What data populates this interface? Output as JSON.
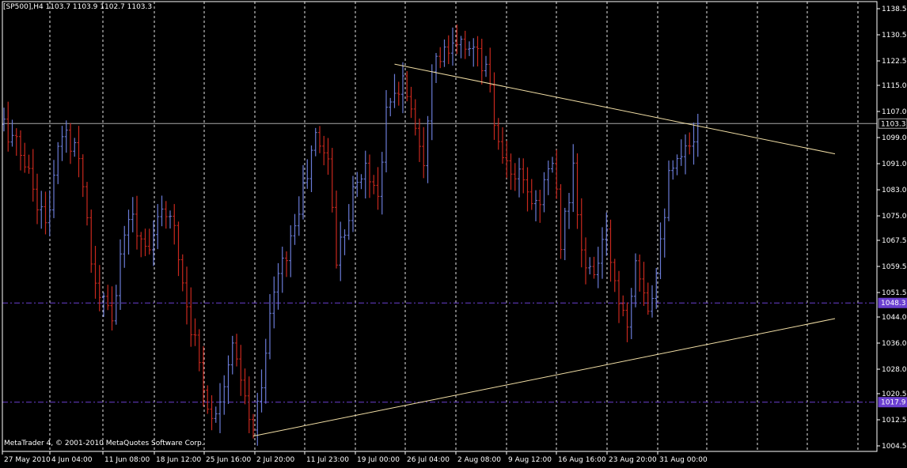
{
  "header": {
    "symbol_info": "[SP500],H4  1103.7 1103.9 1102.7 1103.3"
  },
  "copyright": "MetaTrader 4, © 2001-2010 MetaQuotes Software Corp.",
  "colors": {
    "background": "#000000",
    "grid": "#ffffff",
    "bull_bar": "#6a7bd6",
    "bear_bar": "#c8281e",
    "trendline": "#f2dfa6",
    "hline_current": "#a8a8a8",
    "hline_levels": "#6a3fd0",
    "axis_text": "#ffffff"
  },
  "chart_data": {
    "type": "ohlc-bar",
    "instrument": "SP500",
    "timeframe": "H4",
    "ylim": [
      1000.0,
      1140.0
    ],
    "y_ticks": [
      1138.5,
      1130.5,
      1122.5,
      1115.0,
      1107.0,
      1099.0,
      1091.0,
      1083.0,
      1075.0,
      1067.5,
      1059.5,
      1051.5,
      1044.0,
      1036.0,
      1028.0,
      1020.5,
      1012.5,
      1004.5
    ],
    "y_tick_labels": [
      "1138.5",
      "1130.5",
      "1122.5",
      "1115.0",
      "1107.0",
      "1099.0",
      "1091.0",
      "1083.0",
      "1075.0",
      "1067.5",
      "1059.5",
      "1051.5",
      "1044.0",
      "1036.0",
      "1028.0",
      "1020.5",
      "1012.5",
      "1004.5"
    ],
    "x_tick_labels": [
      "27 May 2010",
      "4 Jun 04:00",
      "11 Jun 08:00",
      "18 Jun 12:00",
      "25 Jun 16:00",
      "2 Jul 20:00",
      "11 Jul 23:00",
      "19 Jul 00:00",
      "26 Jul 04:00",
      "2 Aug 08:00",
      "9 Aug 12:00",
      "16 Aug 16:00",
      "23 Aug 20:00",
      "31 Aug 00:00"
    ],
    "horizontal_lines": [
      {
        "price": 1103.3,
        "label": "1103.3",
        "style": "current"
      },
      {
        "price": 1048.3,
        "label": "1048.3",
        "style": "level"
      },
      {
        "price": 1017.9,
        "label": "1017.9",
        "style": "level"
      }
    ],
    "trendlines": [
      {
        "from_bar": 94,
        "from_price": 1121.5,
        "to_bar": 200,
        "to_price": 1094.0
      },
      {
        "from_bar": 60,
        "from_price": 1007.5,
        "to_bar": 200,
        "to_price": 1043.5
      }
    ],
    "price_path": [
      [
        0,
        1103
      ],
      [
        5,
        1092
      ],
      [
        10,
        1072
      ],
      [
        14,
        1100
      ],
      [
        18,
        1096
      ],
      [
        22,
        1052
      ],
      [
        26,
        1044
      ],
      [
        30,
        1076
      ],
      [
        34,
        1066
      ],
      [
        40,
        1078
      ],
      [
        44,
        1048
      ],
      [
        50,
        1012
      ],
      [
        55,
        1034
      ],
      [
        60,
        1008
      ],
      [
        65,
        1052
      ],
      [
        70,
        1072
      ],
      [
        75,
        1099
      ],
      [
        78,
        1093
      ],
      [
        80,
        1062
      ],
      [
        84,
        1082
      ],
      [
        87,
        1090
      ],
      [
        90,
        1082
      ],
      [
        92,
        1106
      ],
      [
        96,
        1117
      ],
      [
        98,
        1109
      ],
      [
        101,
        1093
      ],
      [
        103,
        1122
      ],
      [
        107,
        1125
      ],
      [
        112,
        1128
      ],
      [
        116,
        1120
      ],
      [
        118,
        1104
      ],
      [
        120,
        1090
      ],
      [
        124,
        1086
      ],
      [
        128,
        1078
      ],
      [
        132,
        1092
      ],
      [
        134,
        1068
      ],
      [
        137,
        1088
      ],
      [
        139,
        1064
      ],
      [
        141,
        1056
      ],
      [
        145,
        1068
      ],
      [
        148,
        1050
      ],
      [
        150,
        1043
      ],
      [
        152,
        1064
      ],
      [
        155,
        1048
      ],
      [
        156,
        1052
      ],
      [
        160,
        1086
      ],
      [
        164,
        1094
      ],
      [
        167,
        1104
      ]
    ]
  }
}
